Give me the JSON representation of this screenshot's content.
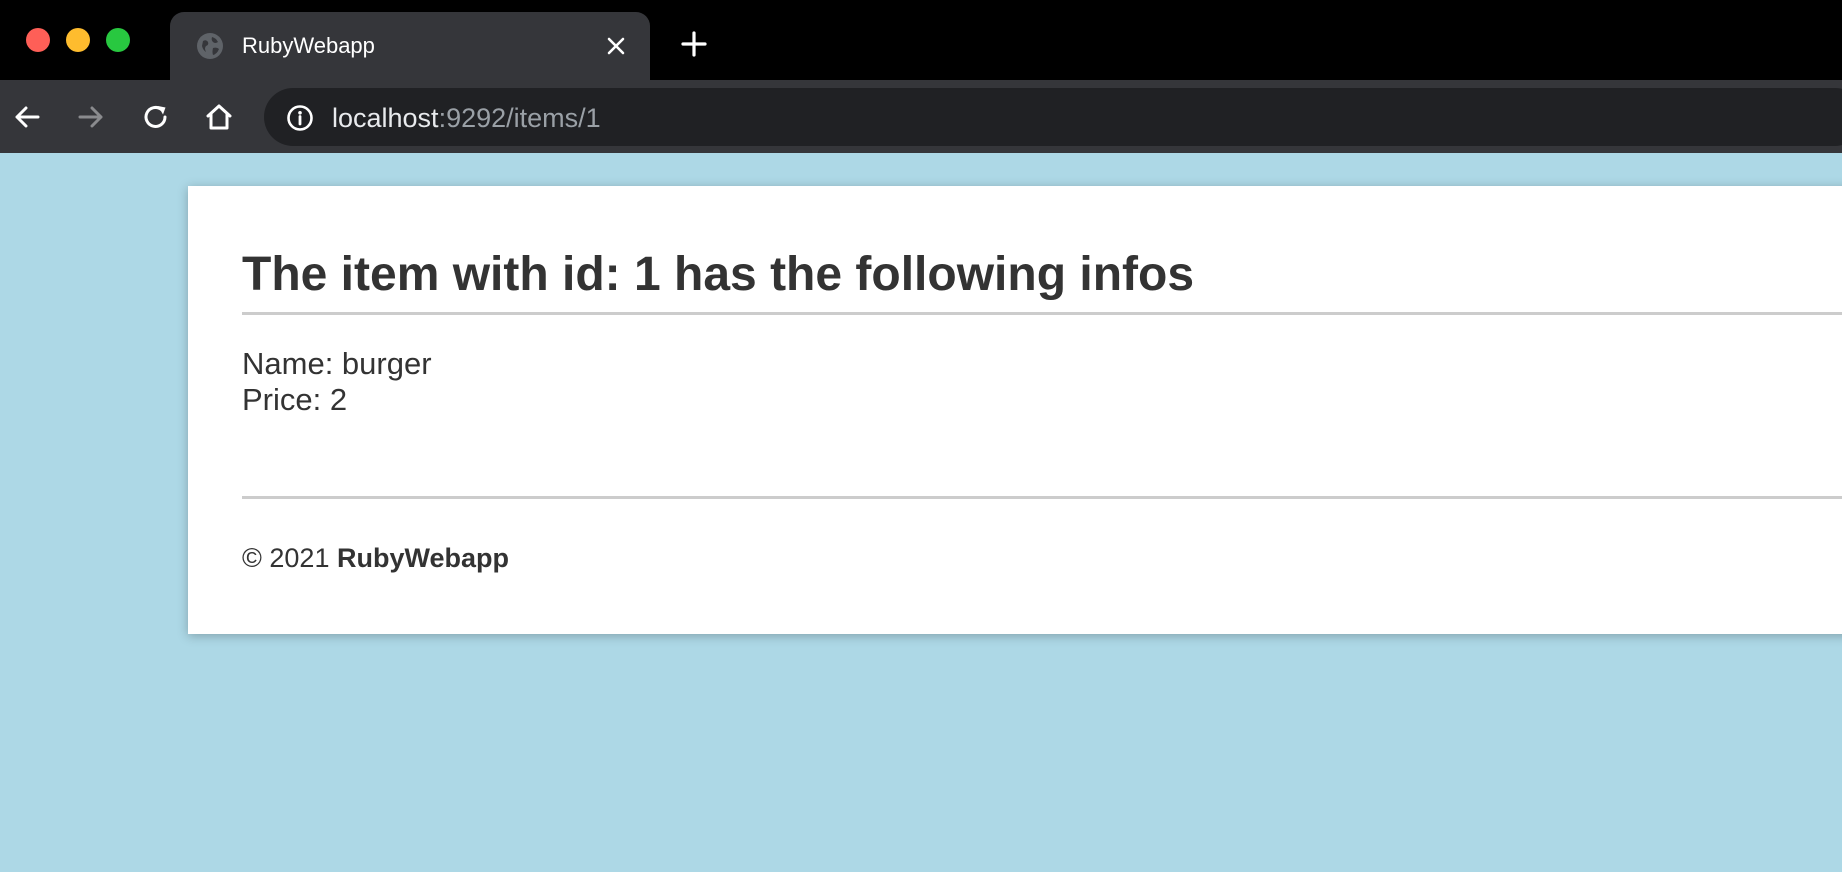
{
  "browser": {
    "tab": {
      "title": "RubyWebapp",
      "favicon": "globe-icon",
      "close_icon": "close-icon"
    },
    "new_tab_icon": "plus-icon",
    "nav": {
      "back_icon": "arrow-left-icon",
      "forward_icon": "arrow-right-icon",
      "reload_icon": "reload-icon",
      "home_icon": "home-icon"
    },
    "address_bar": {
      "info_icon": "info-icon",
      "host": "localhost",
      "path": ":9292/items/1"
    }
  },
  "page": {
    "title": "The item with id: 1 has the following infos",
    "details": {
      "name": "Name: burger",
      "price": "Price: 2"
    },
    "footer": {
      "copyright": "© 2021",
      "brand": "RubyWebapp"
    }
  },
  "colors": {
    "page_background": "#add8e6",
    "card_background": "#ffffff",
    "text": "#333333",
    "rule": "#cccccc",
    "chrome_dark": "#000000",
    "chrome_toolbar": "#35363a",
    "omnibox": "#202124"
  }
}
